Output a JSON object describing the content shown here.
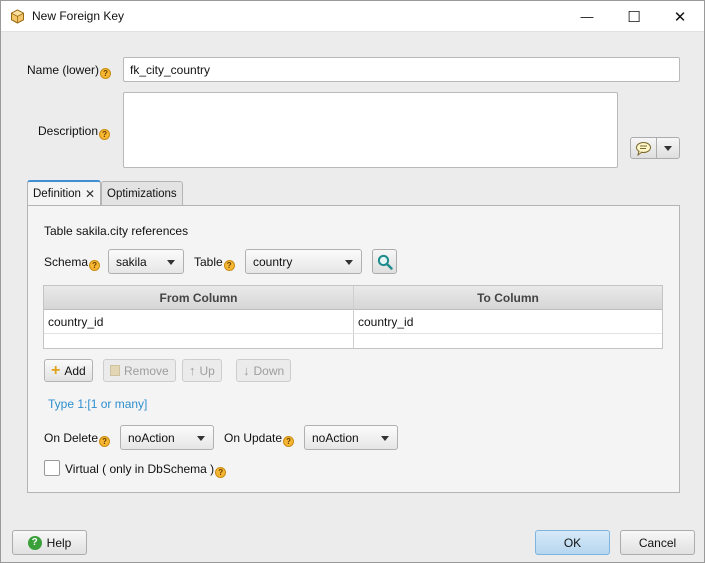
{
  "window": {
    "title": "New Foreign Key",
    "minimize_glyph": "—",
    "maximize_glyph": "☐",
    "close_glyph": "✕"
  },
  "form": {
    "name_label": "Name (lower)",
    "name_value": "fk_city_country",
    "description_label": "Description",
    "description_value": "",
    "help_glyph": "?"
  },
  "tabs": [
    {
      "label": "Definition",
      "active": true,
      "close_glyph": "✕"
    },
    {
      "label": "Optimizations",
      "active": false
    }
  ],
  "definition": {
    "references_text": "Table sakila.city references",
    "schema_label": "Schema",
    "schema_value": "sakila",
    "table_label": "Table",
    "table_value": "country",
    "columns": {
      "headers": [
        "From Column",
        "To Column"
      ],
      "rows": [
        [
          "country_id",
          "country_id"
        ]
      ]
    },
    "buttons": {
      "add": "Add",
      "remove": "Remove",
      "up": "Up",
      "down": "Down"
    },
    "type_link": "Type 1:[1 or many]",
    "on_delete_label": "On Delete",
    "on_delete_value": "noAction",
    "on_update_label": "On Update",
    "on_update_value": "noAction",
    "virtual_label": "Virtual ( only in DbSchema )",
    "virtual_checked": false
  },
  "footer": {
    "help": "Help",
    "ok": "OK",
    "cancel": "Cancel"
  },
  "colors": {
    "accent": "#3f8fd2",
    "link": "#2f8fcf",
    "help_dot": "#f5b733"
  },
  "icons": [
    "app-icon",
    "help-icon",
    "comment-icon",
    "search-icon",
    "add-icon",
    "remove-icon",
    "up-arrow-icon",
    "down-arrow-icon"
  ]
}
